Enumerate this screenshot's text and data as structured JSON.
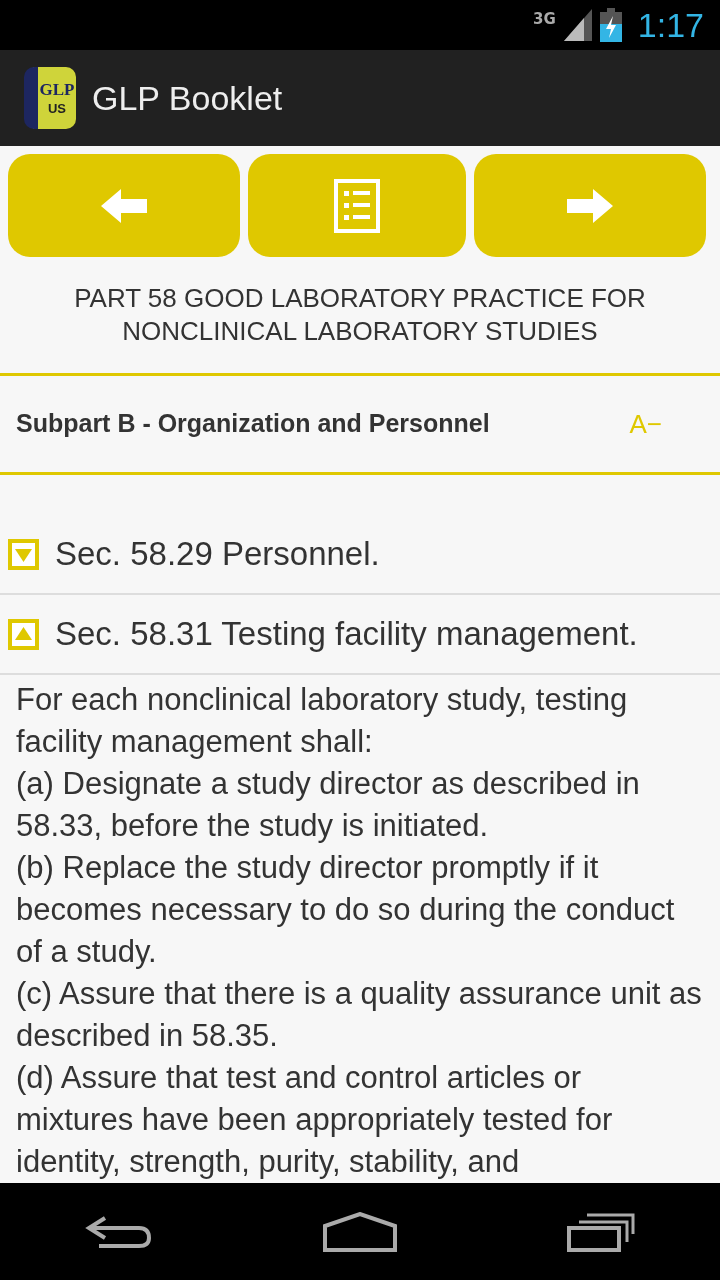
{
  "status_bar": {
    "network": "3G",
    "time": "1:17"
  },
  "app_bar": {
    "logo_top": "GLP",
    "logo_bottom": "US",
    "title": "GLP Booklet"
  },
  "nav_buttons": [
    {
      "kind": "previous"
    },
    {
      "kind": "contents"
    },
    {
      "kind": "next"
    }
  ],
  "part_title": "PART 58 GOOD LABORATORY PRACTICE FOR NONCLINICAL LABORATORY STUDIES",
  "subpart": {
    "title": "Subpart B - Organization and Personnel",
    "font_button": "A−"
  },
  "sections": [
    {
      "title": "Sec. 58.29 Personnel.",
      "expanded": false
    },
    {
      "title": "Sec. 58.31 Testing facility management.",
      "expanded": true,
      "paragraphs": [
        "For each nonclinical laboratory study, testing facility management shall:",
        "(a) Designate a study director as described in 58.33, before the study is initiated.",
        "(b) Replace the study director promptly if it becomes necessary to do so during the conduct of a study.",
        "(c) Assure that there is a quality assurance unit as described in 58.35.",
        "(d) Assure that test and control articles or mixtures have been appropriately tested for identity, strength, purity, stability, and"
      ]
    }
  ]
}
